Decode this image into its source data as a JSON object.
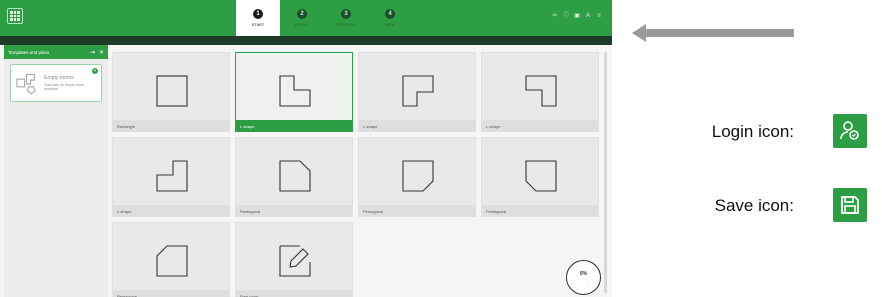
{
  "topbar": {
    "steps": [
      {
        "num": "1",
        "label": "START",
        "active": true
      },
      {
        "num": "2",
        "label": "ROOLS",
        "active": false
      },
      {
        "num": "3",
        "label": "PORSION",
        "active": false
      },
      {
        "num": "4",
        "label": "VIEW",
        "active": false
      }
    ],
    "tool_icons": [
      "✂",
      "ⓘ",
      "▣",
      "A",
      "≡"
    ]
  },
  "left_panel": {
    "title": "Templates and plans",
    "empty_room": {
      "title": "Empty rooms",
      "description": "Start with an empty room template"
    }
  },
  "tiles": [
    {
      "label": "Rectangle",
      "shape": "rect",
      "selected": false
    },
    {
      "label": "L-shape",
      "shape": "l1",
      "selected": true
    },
    {
      "label": "L-shape",
      "shape": "l2",
      "selected": false
    },
    {
      "label": "L-shape",
      "shape": "l3",
      "selected": false
    },
    {
      "label": "L-shape",
      "shape": "l4",
      "selected": false
    },
    {
      "label": "Pentagonal",
      "shape": "p1",
      "selected": false
    },
    {
      "label": "Pentagonal",
      "shape": "p2",
      "selected": false
    },
    {
      "label": "Pentagonal",
      "shape": "p3",
      "selected": false
    },
    {
      "label": "Pentagonal",
      "shape": "p4",
      "selected": false
    },
    {
      "label": "Free room",
      "shape": "free",
      "selected": false
    }
  ],
  "progress": {
    "value": "0%",
    "nav": "← →"
  },
  "legend": {
    "login_label": "Login icon:",
    "save_label": "Save icon:"
  },
  "colors": {
    "accent": "#2e9e45",
    "dark": "#1e3b2a"
  }
}
